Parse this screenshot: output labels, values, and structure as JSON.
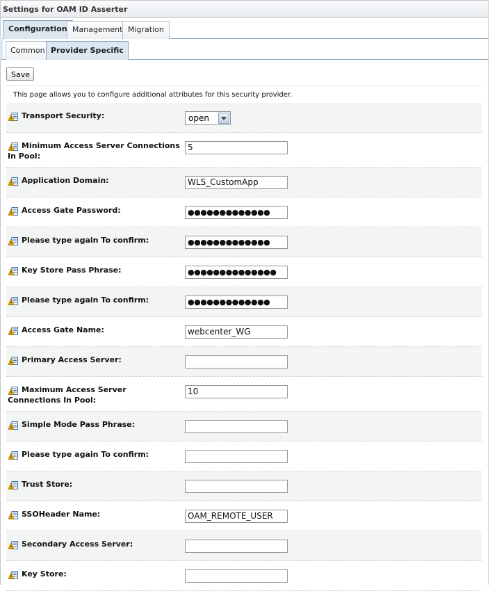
{
  "window": {
    "title": "Settings for OAM ID Asserter"
  },
  "tabs": [
    {
      "label": "Configuration",
      "active": true
    },
    {
      "label": "Management",
      "active": false
    },
    {
      "label": "Migration",
      "active": false
    }
  ],
  "subtabs": [
    {
      "label": "Common",
      "active": false
    },
    {
      "label": "Provider Specific",
      "active": true
    }
  ],
  "toolbar": {
    "save_label": "Save"
  },
  "description": "This page allows you to configure additional attributes for this security provider.",
  "icons": {
    "field_icon": "help-warning-icon"
  },
  "fields": [
    {
      "label": "Transport Security:",
      "type": "select",
      "value": "open"
    },
    {
      "label": "Minimum Access Server Connections In Pool:",
      "type": "text",
      "value": "5"
    },
    {
      "label": "Application Domain:",
      "type": "text",
      "value": "WLS_CustomApp"
    },
    {
      "label": "Access Gate Password:",
      "type": "password",
      "value": "●●●●●●●●●●●●●"
    },
    {
      "label": "Please type again To confirm:",
      "type": "password",
      "value": "●●●●●●●●●●●●●"
    },
    {
      "label": "Key Store Pass Phrase:",
      "type": "password",
      "value": "●●●●●●●●●●●●●●"
    },
    {
      "label": "Please type again To confirm:",
      "type": "password",
      "value": "●●●●●●●●●●●●●"
    },
    {
      "label": "Access Gate Name:",
      "type": "text",
      "value": "webcenter_WG"
    },
    {
      "label": "Primary Access Server:",
      "type": "text",
      "value": ""
    },
    {
      "label": "Maximum Access Server Connections In Pool:",
      "type": "text",
      "value": "10"
    },
    {
      "label": "Simple Mode Pass Phrase:",
      "type": "password",
      "value": ""
    },
    {
      "label": "Please type again To confirm:",
      "type": "password",
      "value": ""
    },
    {
      "label": "Trust Store:",
      "type": "text",
      "value": ""
    },
    {
      "label": "SSOHeader Name:",
      "type": "text",
      "value": "OAM_REMOTE_USER"
    },
    {
      "label": "Secondary Access Server:",
      "type": "text",
      "value": ""
    },
    {
      "label": "Key Store:",
      "type": "text",
      "value": ""
    }
  ]
}
